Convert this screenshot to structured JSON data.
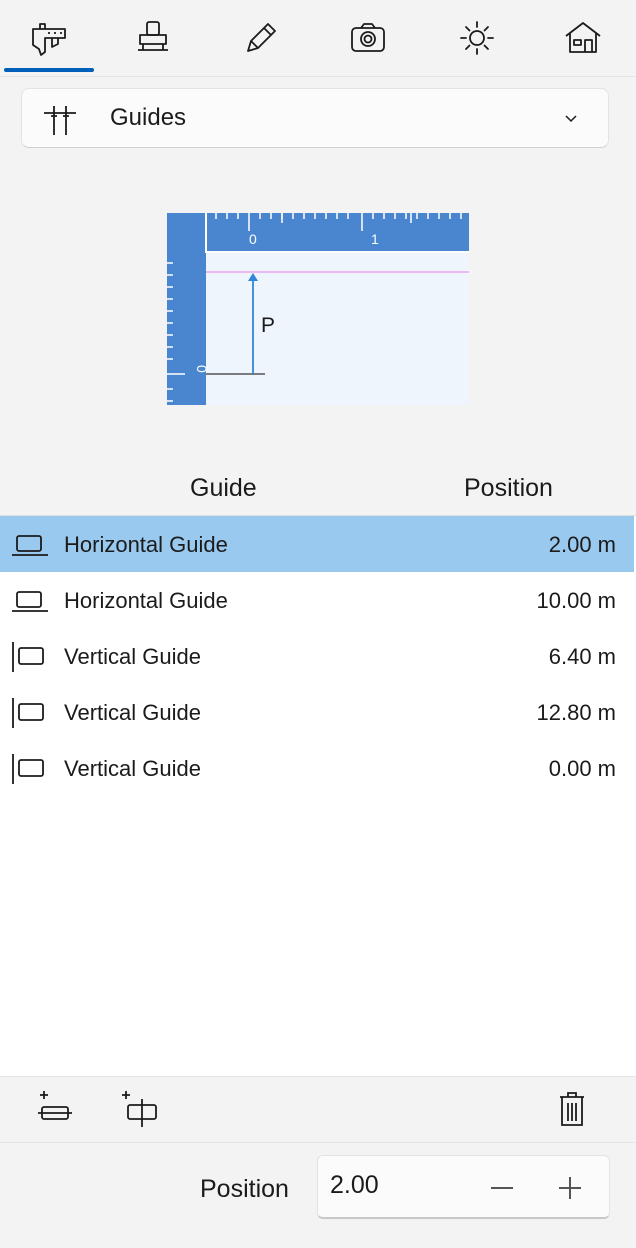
{
  "toolbar": {
    "tools": [
      {
        "icon": "caliper-icon",
        "selected": true
      },
      {
        "icon": "stamp-icon",
        "selected": false
      },
      {
        "icon": "pencil-icon",
        "selected": false
      },
      {
        "icon": "camera-icon",
        "selected": false
      },
      {
        "icon": "sun-icon",
        "selected": false
      },
      {
        "icon": "house-icon",
        "selected": false
      }
    ],
    "accent": "#005fb8"
  },
  "mode_dropdown": {
    "icon": "guides-icon",
    "label": "Guides",
    "chevron": "chevron-down-icon"
  },
  "illustration": {
    "ruler_ticks_top": [
      "0",
      "1"
    ],
    "ruler_tick_left": "0",
    "arrow_label": "P",
    "ruler_color": "#4a86cf",
    "guide_line_color": "#e9a6ee"
  },
  "list": {
    "headers": {
      "guide": "Guide",
      "position": "Position"
    },
    "rows": [
      {
        "type": "horizontal",
        "icon": "horizontal-guide-icon",
        "label": "Horizontal Guide",
        "value": "2.00 m",
        "selected": true
      },
      {
        "type": "horizontal",
        "icon": "horizontal-guide-icon",
        "label": "Horizontal Guide",
        "value": "10.00 m",
        "selected": false
      },
      {
        "type": "vertical",
        "icon": "vertical-guide-icon",
        "label": "Vertical Guide",
        "value": "6.40 m",
        "selected": false
      },
      {
        "type": "vertical",
        "icon": "vertical-guide-icon",
        "label": "Vertical Guide",
        "value": "12.80 m",
        "selected": false
      },
      {
        "type": "vertical",
        "icon": "vertical-guide-icon",
        "label": "Vertical Guide",
        "value": "0.00 m",
        "selected": false
      }
    ],
    "selected_color": "#99c9ef"
  },
  "actions": {
    "add_horizontal": "add-horizontal-guide-icon",
    "add_vertical": "add-vertical-guide-icon",
    "delete": "trash-icon"
  },
  "position_field": {
    "label": "Position",
    "value": "2.00",
    "minus": "minus-icon",
    "plus": "plus-icon"
  }
}
